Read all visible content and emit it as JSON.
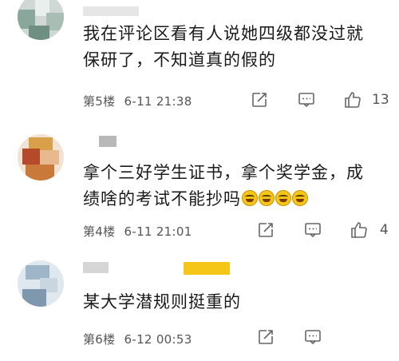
{
  "comments": [
    {
      "text_line1": "我在评论区看有人说她四级都没过就",
      "text_line2": "保研了，不知道真的假的",
      "floor": "第5楼",
      "time": "6-11 21:38",
      "likes": "13",
      "icons": [
        "share-icon",
        "comment-icon",
        "like-icon"
      ]
    },
    {
      "text_line1": "拿个三好学生证书，拿个奖学金，成",
      "text_line2": "绩啥的考试不能抄吗",
      "floor": "第4楼",
      "time": "6-11 21:01",
      "likes": "4",
      "icons": [
        "share-icon",
        "comment-icon",
        "like-icon"
      ]
    },
    {
      "text_line1": "某大学潜规则挺重的",
      "floor": "第6楼",
      "time": "6-12 00:53",
      "icons": [
        "share-icon",
        "comment-icon"
      ]
    }
  ],
  "colors": {
    "text": "#1a1a1a",
    "meta": "#555555",
    "icon": "#666666",
    "highlight_bar": "#f5c518"
  }
}
